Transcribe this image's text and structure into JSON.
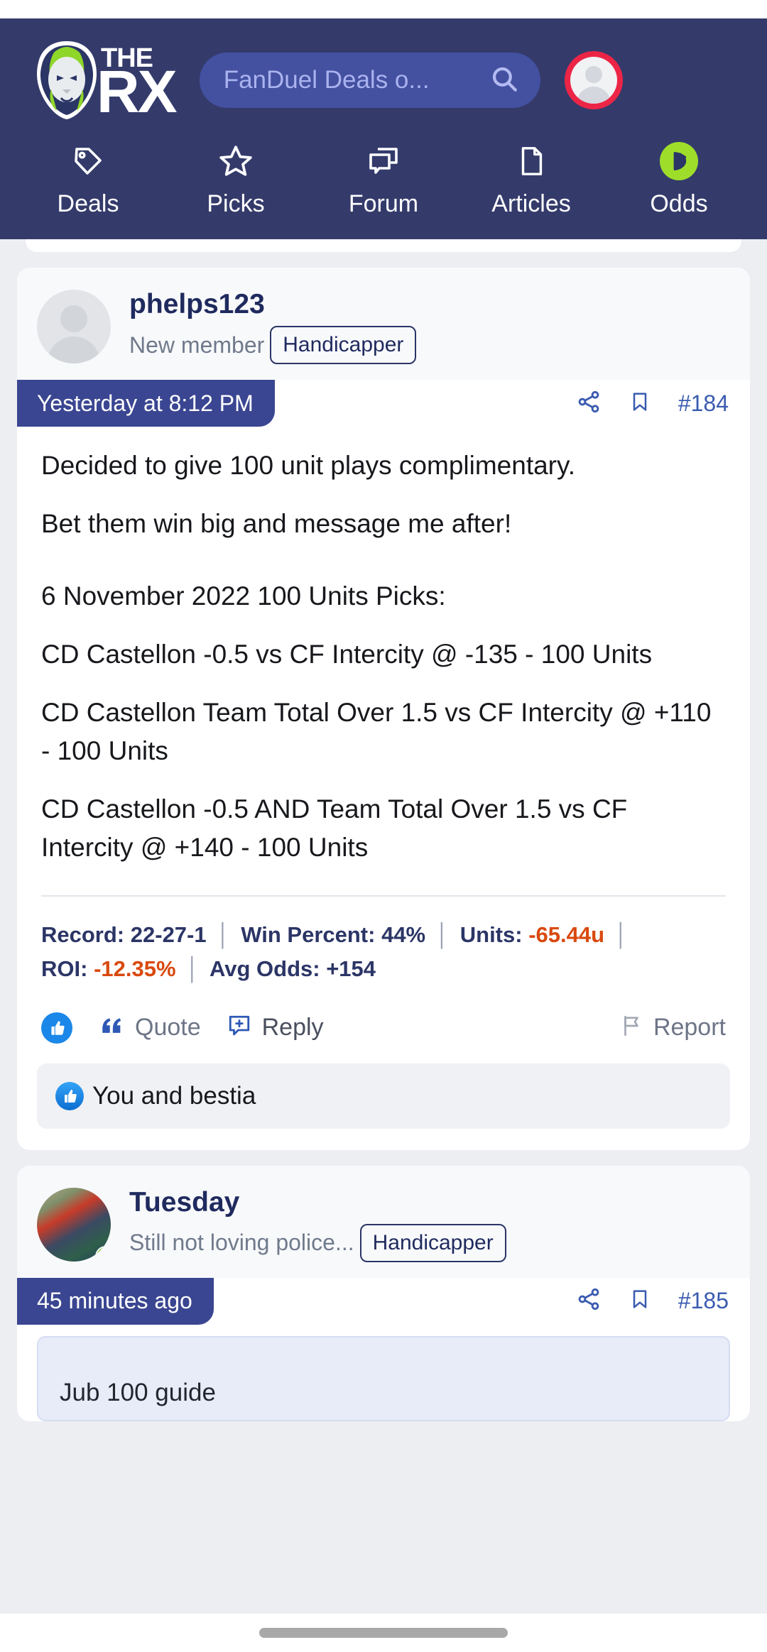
{
  "header": {
    "logo_the": "THE",
    "logo_rx": "RX",
    "search": {
      "value": "FanDuel Deals o...",
      "icon": "search-icon"
    },
    "account_icon": "user-avatar-icon",
    "nav": [
      {
        "label": "Deals",
        "icon": "tag-icon"
      },
      {
        "label": "Picks",
        "icon": "star-icon"
      },
      {
        "label": "Forum",
        "icon": "chat-bubbles-icon"
      },
      {
        "label": "Articles",
        "icon": "document-icon"
      },
      {
        "label": "Odds",
        "icon": "odds-badge-icon"
      }
    ]
  },
  "posts": [
    {
      "username": "phelps123",
      "user_title": "New member",
      "badge": "Handicapper",
      "timestamp": "Yesterday at 8:12 PM",
      "post_number": "#184",
      "share_icon": "share-icon",
      "bookmark_icon": "bookmark-icon",
      "body": [
        "Decided to give 100 unit plays complimentary.",
        "Bet them win big and message me after!",
        "",
        "6 November 2022 100 Units Picks:",
        "CD Castellon -0.5 vs CF Intercity @ -135 - 100 Units",
        "CD Castellon Team Total Over 1.5 vs CF Intercity @ +110 - 100 Units",
        "CD Castellon -0.5 AND Team Total Over 1.5 vs CF Intercity @ +140 - 100 Units"
      ],
      "stats": {
        "record_label": "Record:",
        "record_value": "22-27-1",
        "win_label": "Win Percent:",
        "win_value": "44%",
        "units_label": "Units:",
        "units_value": "-65.44u",
        "roi_label": "ROI:",
        "roi_value": "-12.35%",
        "avg_label": "Avg Odds:",
        "avg_value": "+154"
      },
      "actions": {
        "like_icon": "thumbs-up-icon",
        "quote_label": "Quote",
        "quote_icon": "quote-marks-icon",
        "reply_label": "Reply",
        "reply_icon": "reply-bubble-icon",
        "report_label": "Report",
        "report_icon": "flag-icon"
      },
      "reactions": {
        "icon": "thumbs-up-reaction-icon",
        "text": "You and bestia"
      }
    },
    {
      "username": "Tuesday",
      "user_title": "Still not loving police...",
      "badge": "Handicapper",
      "timestamp": "45 minutes ago",
      "post_number": "#185",
      "share_icon": "share-icon",
      "bookmark_icon": "bookmark-icon",
      "quote_preview": "Jub 100 guide"
    }
  ],
  "colors": {
    "header_bg": "#343b6b",
    "accent_blue": "#3a4691",
    "link_blue": "#3a5bb0",
    "negative": "#d9490e",
    "odds_green": "#9ede2a",
    "notify_red": "#ec2546"
  }
}
